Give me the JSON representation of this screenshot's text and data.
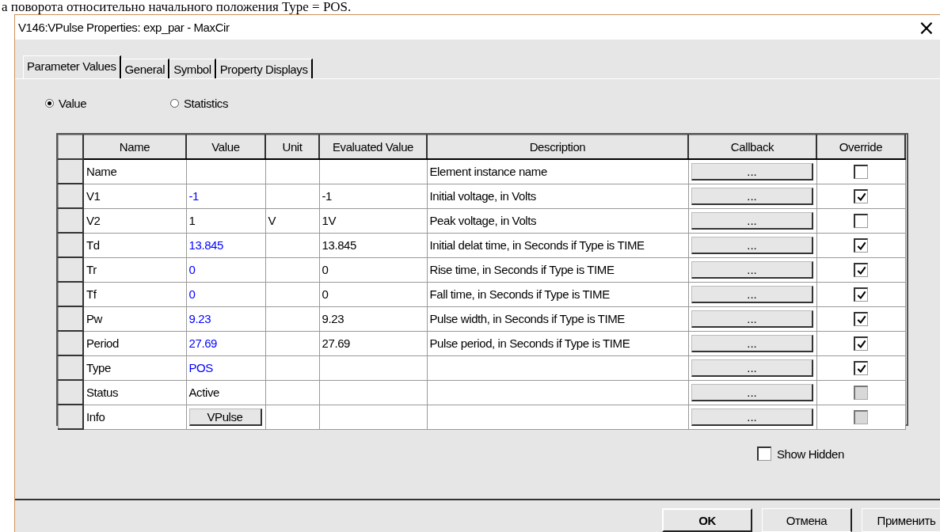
{
  "background_text": "а поворота относительно начального положения Type = POS.",
  "window": {
    "title": "V146:VPulse Properties: exp_par - MaxCir",
    "close": "×"
  },
  "tabs": [
    {
      "label": "Parameter Values",
      "selected": true
    },
    {
      "label": "General",
      "selected": false
    },
    {
      "label": "Symbol",
      "selected": false
    },
    {
      "label": "Property Displays",
      "selected": false
    }
  ],
  "radios": [
    {
      "label": "Value",
      "selected": true
    },
    {
      "label": "Statistics",
      "selected": false
    }
  ],
  "table": {
    "columns": [
      "Name",
      "Value",
      "Unit",
      "Evaluated Value",
      "Description",
      "Callback",
      "Override"
    ],
    "rows": [
      {
        "name": "Name",
        "value": "",
        "unit": "",
        "evaluated": "",
        "description": "Element instance name",
        "callback": "...",
        "checked": false,
        "disabled": false
      },
      {
        "name": "V1",
        "value": "-1",
        "color": "#0000ff",
        "unit": "",
        "evaluated": "-1",
        "description": "Initial voltage, in Volts",
        "callback": "...",
        "checked": true,
        "disabled": false
      },
      {
        "name": "V2",
        "value": "1",
        "color": "#000000",
        "unit": "V",
        "evaluated": "1V",
        "description": "Peak voltage, in Volts",
        "callback": "...",
        "checked": false,
        "disabled": false
      },
      {
        "name": "Td",
        "value": "13.845",
        "color": "#0000ff",
        "unit": "",
        "evaluated": "13.845",
        "description": "Initial delat time, in Seconds if Type is TIME",
        "callback": "...",
        "checked": true,
        "disabled": false
      },
      {
        "name": "Tr",
        "value": "0",
        "color": "#0000ff",
        "unit": "",
        "evaluated": "0",
        "description": "Rise time, in Seconds if Type is TIME",
        "callback": "...",
        "checked": true,
        "disabled": false
      },
      {
        "name": "Tf",
        "value": "0",
        "color": "#0000ff",
        "unit": "",
        "evaluated": "0",
        "description": "Fall time, in Seconds if Type is TIME",
        "callback": "...",
        "checked": true,
        "disabled": false
      },
      {
        "name": "Pw",
        "value": "9.23",
        "color": "#0000ff",
        "unit": "",
        "evaluated": "9.23",
        "description": "Pulse width, in Seconds if Type is TIME",
        "callback": "...",
        "checked": true,
        "disabled": false
      },
      {
        "name": "Period",
        "value": "27.69",
        "color": "#0000ff",
        "unit": "",
        "evaluated": "27.69",
        "description": "Pulse period, in Seconds if Type is TIME",
        "callback": "...",
        "checked": true,
        "disabled": false
      },
      {
        "name": "Type",
        "value": "POS",
        "color": "#0000ff",
        "unit": "",
        "evaluated": "",
        "description": "",
        "callback": "...",
        "checked": true,
        "disabled": false
      },
      {
        "name": "Status",
        "value": "Active",
        "color": "#000000",
        "unit": "",
        "evaluated": "",
        "description": "",
        "callback": "...",
        "checked": false,
        "disabled": true
      },
      {
        "name": "Info",
        "value": "VPulse",
        "kind": "button",
        "unit": "",
        "evaluated": "",
        "description": "",
        "callback": "...",
        "checked": false,
        "disabled": true
      }
    ]
  },
  "show_hidden": {
    "label": "Show Hidden",
    "checked": false
  },
  "buttons": [
    {
      "label": "OK",
      "default": true
    },
    {
      "label": "Отмена",
      "default": false
    },
    {
      "label": "Применить",
      "default": false
    }
  ]
}
